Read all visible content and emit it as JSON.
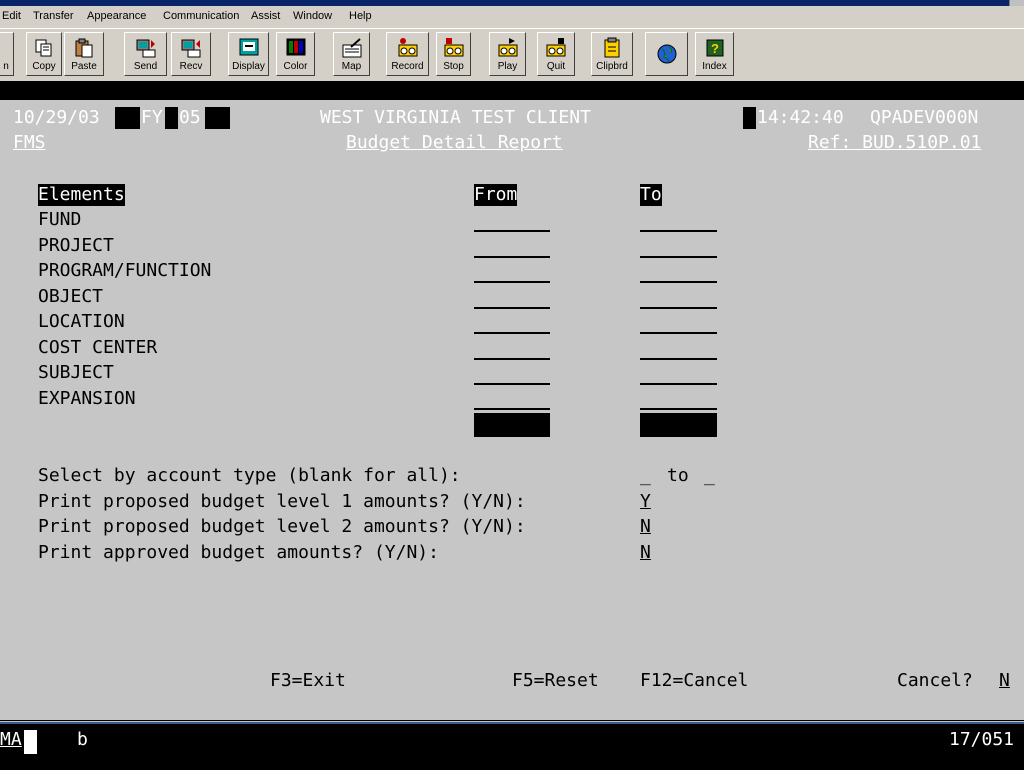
{
  "menu": {
    "items": [
      {
        "label": "Edit"
      },
      {
        "label": "Transfer"
      },
      {
        "label": "Appearance"
      },
      {
        "label": "Communication"
      },
      {
        "label": "Assist"
      },
      {
        "label": "Window"
      },
      {
        "label": "Help"
      }
    ]
  },
  "toolbar": {
    "buttons": [
      {
        "label": "n",
        "icon": "print-icon"
      },
      {
        "label": "Copy",
        "icon": "copy-icon"
      },
      {
        "label": "Paste",
        "icon": "paste-icon"
      },
      {
        "label": "Send",
        "icon": "send-icon"
      },
      {
        "label": "Recv",
        "icon": "receive-icon"
      },
      {
        "label": "Display",
        "icon": "display-icon"
      },
      {
        "label": "Color",
        "icon": "color-icon"
      },
      {
        "label": "Map",
        "icon": "map-icon"
      },
      {
        "label": "Record",
        "icon": "record-icon"
      },
      {
        "label": "Stop",
        "icon": "stop-icon"
      },
      {
        "label": "Play",
        "icon": "play-icon"
      },
      {
        "label": "Quit",
        "icon": "quit-icon"
      },
      {
        "label": "Clipbrd",
        "icon": "clipboard-icon"
      },
      {
        "label": "",
        "icon": "globe-icon"
      },
      {
        "label": "Index",
        "icon": "help-index-icon"
      }
    ]
  },
  "header": {
    "date": "10/29/03",
    "fy_label": "FY",
    "fy_value": "05",
    "client": "WEST VIRGINIA TEST CLIENT",
    "time": "14:42:40",
    "session": "QPADEV000N",
    "system": "FMS",
    "report_title": "Budget Detail Report",
    "ref": "Ref: BUD.510P.01"
  },
  "form": {
    "col_elements": "Elements",
    "col_from": "From",
    "col_to": "To",
    "elements": [
      "FUND",
      "PROJECT",
      "PROGRAM/FUNCTION",
      "OBJECT",
      "LOCATION",
      "COST CENTER",
      "SUBJECT",
      "EXPANSION"
    ],
    "account_type_label": "Select by account type (blank for all):",
    "account_type_from": "_",
    "account_type_to_word": "to",
    "account_type_to": "_",
    "level1_label": "Print proposed budget level 1 amounts? (Y/N):",
    "level1_value": "Y",
    "level2_label": "Print proposed budget level 2 amounts? (Y/N):",
    "level2_value": "N",
    "approved_label": "Print approved budget amounts? (Y/N):",
    "approved_value": "N"
  },
  "fkeys": {
    "exit": "F3=Exit",
    "reset": "F5=Reset",
    "cancel": "F12=Cancel",
    "cancel_prompt": "Cancel?",
    "cancel_value": "N"
  },
  "status": {
    "mode": "MA",
    "indicator": "b",
    "cursor_pos": "17/051"
  }
}
